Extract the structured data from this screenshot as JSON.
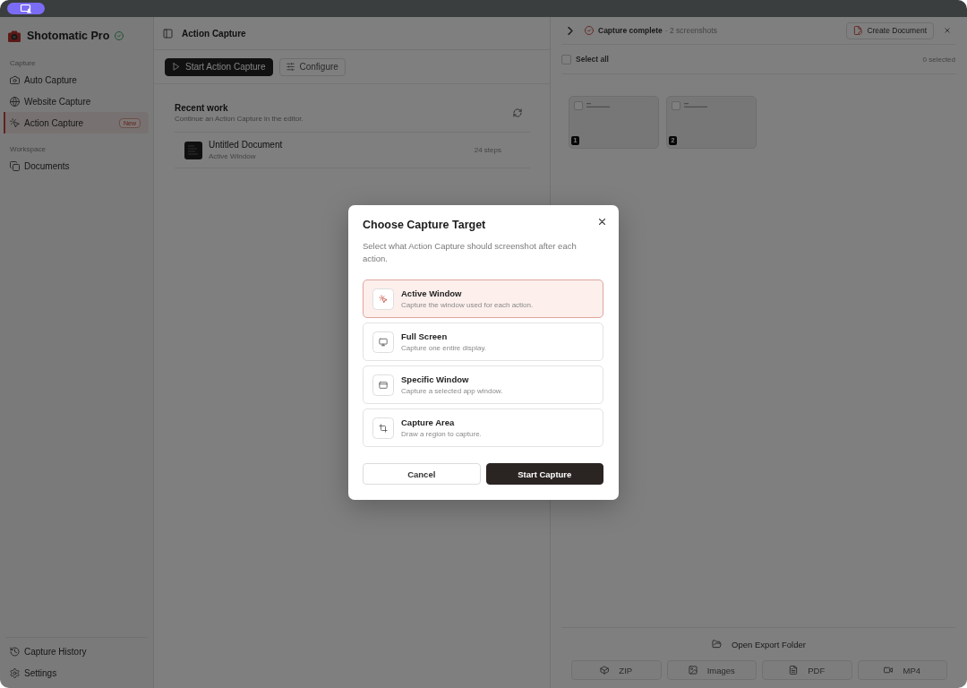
{
  "sidebar": {
    "app_name": "Shotomatic Pro",
    "sections": [
      {
        "label": "Capture",
        "items": [
          {
            "label": "Auto Capture",
            "selected": false
          },
          {
            "label": "Website Capture",
            "selected": false
          },
          {
            "label": "Action Capture",
            "selected": true,
            "badge": "New"
          }
        ]
      },
      {
        "label": "Workspace",
        "items": [
          {
            "label": "Documents",
            "selected": false
          }
        ]
      }
    ],
    "footer_items": [
      {
        "label": "Capture History"
      },
      {
        "label": "Settings"
      }
    ]
  },
  "main": {
    "title": "Action Capture",
    "toolbar": [
      {
        "label": "Start Action Capture",
        "kind": "primary"
      },
      {
        "label": "Configure",
        "kind": "secondary"
      }
    ],
    "recent": {
      "title": "Recent work",
      "subtitle": "Continue an Action Capture in the editor.",
      "items": [
        {
          "title": "Untitled Document",
          "subtitle": "Active Window",
          "steps": "24 steps"
        }
      ]
    }
  },
  "results_panel": {
    "status": "Capture complete",
    "detail": "· 2 screenshots",
    "create_button": "Create Document",
    "select_all": {
      "label": "Select all",
      "checked": false
    },
    "selected_count": "0 selected",
    "screenshots": [
      {
        "number": "1",
        "checked": false
      },
      {
        "number": "2",
        "checked": false
      }
    ],
    "open_folder": "Open Export Folder",
    "export_buttons": [
      "ZIP",
      "Images",
      "PDF",
      "MP4"
    ]
  },
  "dialog": {
    "title": "Choose Capture Target",
    "description": "Select what Action Capture should screenshot after each action.",
    "options": [
      {
        "title": "Active Window",
        "description": "Capture the window used for each action.",
        "selected": true
      },
      {
        "title": "Full Screen",
        "description": "Capture one entire display.",
        "selected": false
      },
      {
        "title": "Specific Window",
        "description": "Capture a selected app window.",
        "selected": false
      },
      {
        "title": "Capture Area",
        "description": "Draw a region to capture.",
        "selected": false
      }
    ],
    "buttons": [
      {
        "label": "Cancel",
        "kind": "secondary"
      },
      {
        "label": "Start Capture",
        "kind": "primary"
      }
    ]
  }
}
